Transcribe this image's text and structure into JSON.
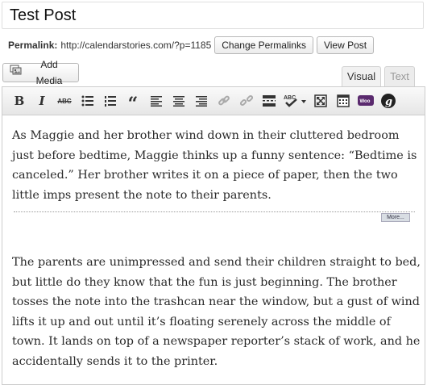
{
  "post": {
    "title": "Test Post"
  },
  "permalink": {
    "label": "Permalink:",
    "url": "http://calendarstories.com/?p=1185",
    "change_button": "Change Permalinks",
    "view_button": "View Post"
  },
  "media": {
    "add_button": "Add Media"
  },
  "editor_tabs": {
    "visual": "Visual",
    "text": "Text"
  },
  "toolbar": {
    "bold": "B",
    "italic": "I",
    "strike": "ABC",
    "quote": "“",
    "more_label": "More...",
    "icons": [
      "bold-icon",
      "italic-icon",
      "strikethrough-icon",
      "bullet-list-icon",
      "numbered-list-icon",
      "blockquote-icon",
      "align-left-icon",
      "align-center-icon",
      "align-right-icon",
      "link-icon",
      "unlink-icon",
      "insert-more-icon",
      "spellcheck-icon",
      "fullscreen-icon",
      "kitchen-sink-icon",
      "woocommerce-icon",
      "plugin-icon"
    ]
  },
  "content": {
    "paragraph1": "As Maggie and her brother wind down in their cluttered bedroom just before bedtime, Maggie thinks up a funny sentence: “Bedtime is canceled.” Her brother writes it on a piece of paper, then the two little imps present the note to their parents.",
    "paragraph2": "The parents are unimpressed and send their children straight to bed, but little do they know that the fun is just beginning. The brother tosses the note into the trashcan near the window, but a gust of wind lifts it up and out until it’s floating serenely across the middle of town. It lands on top of a newspaper reporter’s stack of work, and he accidentally sends it to the printer."
  }
}
